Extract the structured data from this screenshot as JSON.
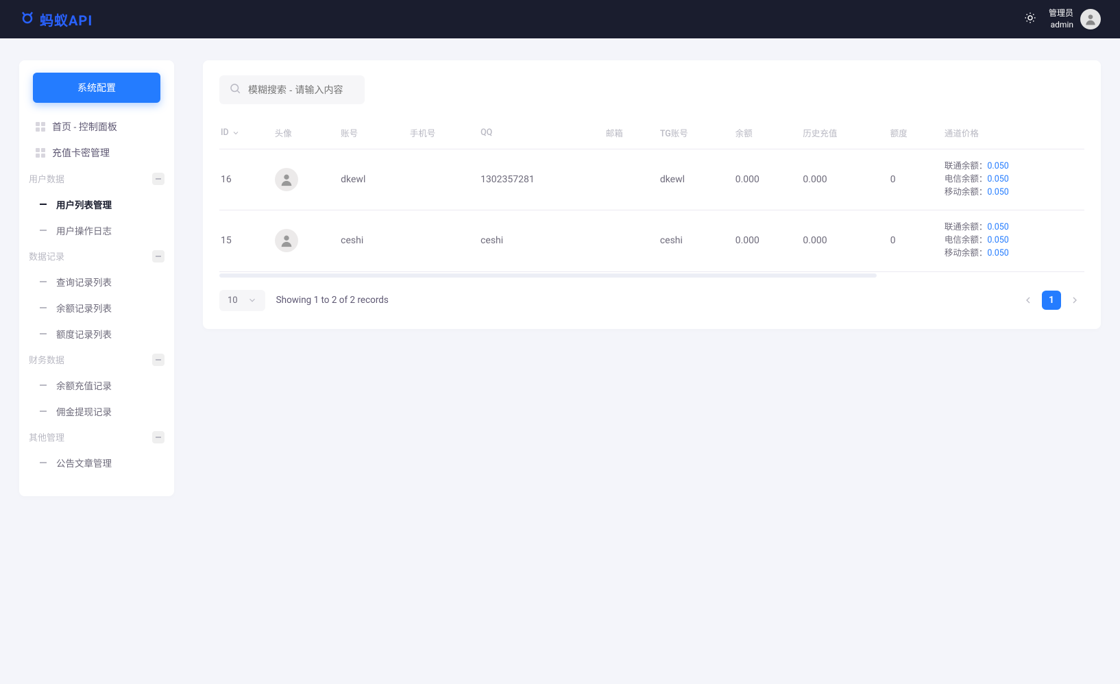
{
  "brand": "蚂蚁API",
  "user": {
    "role": "管理员",
    "name": "admin"
  },
  "sidebar": {
    "config_btn": "系统配置",
    "top": [
      {
        "label": "首页 - 控制面板"
      },
      {
        "label": "充值卡密管理"
      }
    ],
    "groups": [
      {
        "label": "用户数据",
        "items": [
          {
            "label": "用户列表管理",
            "active": true
          },
          {
            "label": "用户操作日志"
          }
        ]
      },
      {
        "label": "数据记录",
        "items": [
          {
            "label": "查询记录列表"
          },
          {
            "label": "余额记录列表"
          },
          {
            "label": "额度记录列表"
          }
        ]
      },
      {
        "label": "财务数据",
        "items": [
          {
            "label": "余额充值记录"
          },
          {
            "label": "佣金提现记录"
          }
        ]
      },
      {
        "label": "其他管理",
        "items": [
          {
            "label": "公告文章管理"
          }
        ]
      }
    ]
  },
  "search": {
    "placeholder": "模糊搜索 - 请输入内容"
  },
  "table": {
    "headers": {
      "id": "ID",
      "avatar": "头像",
      "account": "账号",
      "phone": "手机号",
      "qq": "QQ",
      "email": "邮箱",
      "tg": "TG账号",
      "balance": "余额",
      "history": "历史充值",
      "quota": "额度",
      "channel": "通道价格"
    },
    "price_labels": {
      "lt": "联通余额：",
      "dx": "电信余额：",
      "yd": "移动余额："
    },
    "rows": [
      {
        "id": "16",
        "account": "dkewl",
        "phone": "",
        "qq": "1302357281",
        "email": "",
        "tg": "dkewl",
        "balance": "0.000",
        "history": "0.000",
        "quota": "0",
        "lt": "0.050",
        "dx": "0.050",
        "yd": "0.050"
      },
      {
        "id": "15",
        "account": "ceshi",
        "phone": "",
        "qq": "ceshi",
        "email": "",
        "tg": "ceshi",
        "balance": "0.000",
        "history": "0.000",
        "quota": "0",
        "lt": "0.050",
        "dx": "0.050",
        "yd": "0.050"
      }
    ]
  },
  "footer": {
    "page_size": "10",
    "records_text": "Showing 1 to 2 of 2 records",
    "current_page": "1"
  }
}
